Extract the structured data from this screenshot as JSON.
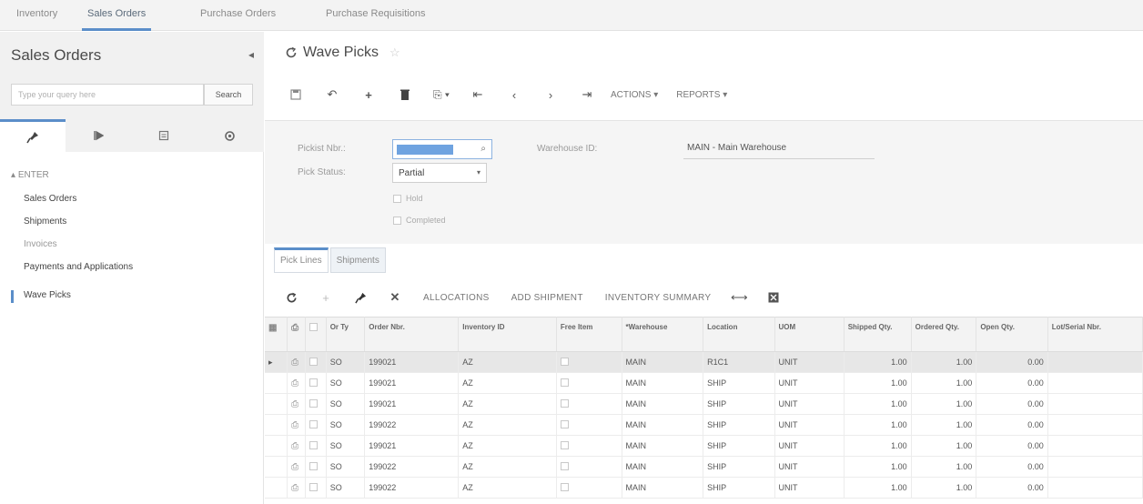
{
  "top_tabs": [
    "Inventory",
    "Sales Orders",
    "Purchase Orders",
    "Purchase Requisitions"
  ],
  "sidebar": {
    "title": "Sales Orders",
    "search_placeholder": "Type your query here",
    "search_button": "Search",
    "section_label": "ENTER",
    "items": [
      {
        "label": "Sales Orders"
      },
      {
        "label": "Shipments"
      },
      {
        "label": "Invoices"
      },
      {
        "label": "Payments and Applications"
      },
      {
        "label": "Wave Picks"
      }
    ]
  },
  "page": {
    "title": "Wave Picks"
  },
  "toolbar": {
    "actions_label": "ACTIONS ▾",
    "reports_label": "REPORTS ▾"
  },
  "form": {
    "ref_nbr_label": "Pickist Nbr.:",
    "pick_status_label": "Pick Status:",
    "pick_status_value": "Partial",
    "hold_label": "Hold",
    "completed_label": "Completed",
    "warehouse_label": "Warehouse ID:",
    "warehouse_value": "MAIN - Main Warehouse"
  },
  "detail_tabs": [
    "Pick Lines",
    "Shipments"
  ],
  "grid_toolbar": {
    "allocations": "ALLOCATIONS",
    "add_shipment": "ADD SHIPMENT",
    "inventory_summary": "INVENTORY SUMMARY"
  },
  "grid": {
    "columns": [
      "",
      "",
      "",
      "Or Ty",
      "Order Nbr.",
      "Inventory ID",
      "Free Item",
      "*Warehouse",
      "Location",
      "UOM",
      "Shipped Qty.",
      "Ordered Qty.",
      "Open Qty.",
      "Lot/Serial Nbr."
    ],
    "rows": [
      {
        "type": "SO",
        "order": "199021",
        "inv": "AZ",
        "wh": "MAIN",
        "loc": "R1C1",
        "uom": "UNIT",
        "shipped": "1.00",
        "ordered": "1.00",
        "open": "0.00"
      },
      {
        "type": "SO",
        "order": "199021",
        "inv": "AZ",
        "wh": "MAIN",
        "loc": "SHIP",
        "uom": "UNIT",
        "shipped": "1.00",
        "ordered": "1.00",
        "open": "0.00"
      },
      {
        "type": "SO",
        "order": "199021",
        "inv": "AZ",
        "wh": "MAIN",
        "loc": "SHIP",
        "uom": "UNIT",
        "shipped": "1.00",
        "ordered": "1.00",
        "open": "0.00"
      },
      {
        "type": "SO",
        "order": "199022",
        "inv": "AZ",
        "wh": "MAIN",
        "loc": "SHIP",
        "uom": "UNIT",
        "shipped": "1.00",
        "ordered": "1.00",
        "open": "0.00"
      },
      {
        "type": "SO",
        "order": "199021",
        "inv": "AZ",
        "wh": "MAIN",
        "loc": "SHIP",
        "uom": "UNIT",
        "shipped": "1.00",
        "ordered": "1.00",
        "open": "0.00"
      },
      {
        "type": "SO",
        "order": "199022",
        "inv": "AZ",
        "wh": "MAIN",
        "loc": "SHIP",
        "uom": "UNIT",
        "shipped": "1.00",
        "ordered": "1.00",
        "open": "0.00"
      },
      {
        "type": "SO",
        "order": "199022",
        "inv": "AZ",
        "wh": "MAIN",
        "loc": "SHIP",
        "uom": "UNIT",
        "shipped": "1.00",
        "ordered": "1.00",
        "open": "0.00"
      }
    ]
  },
  "colors": {
    "accent": "#5b8ec9",
    "link": "#6b7bd1"
  },
  "icons": [
    "save-icon",
    "undo-icon",
    "add-icon",
    "delete-icon",
    "copy-icon",
    "first-icon",
    "prev-icon",
    "next-icon",
    "last-icon",
    "refresh-icon",
    "edit-icon",
    "close-icon",
    "fit-icon",
    "export-icon",
    "star-icon",
    "pin-icon",
    "play-icon",
    "doc-icon",
    "gear-icon"
  ]
}
